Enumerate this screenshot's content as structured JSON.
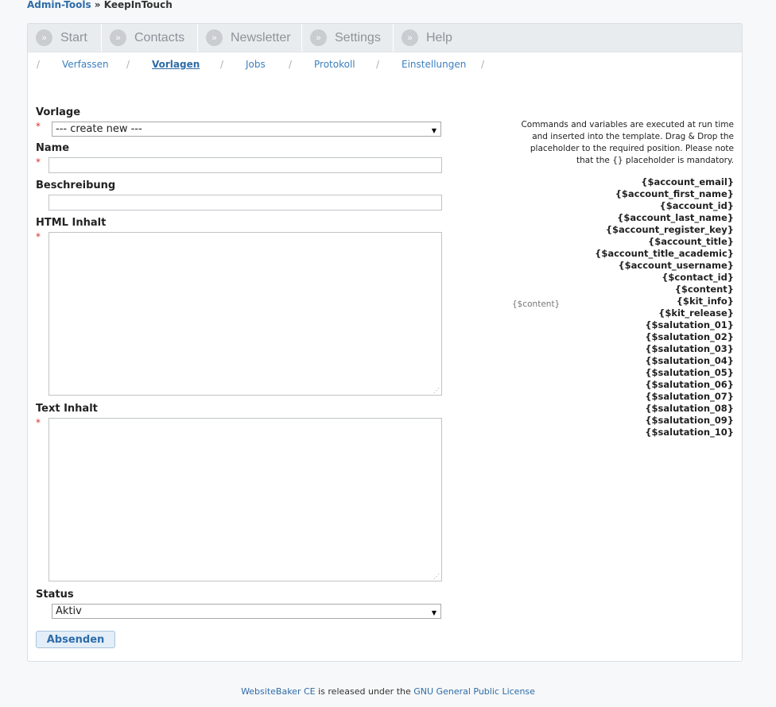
{
  "breadcrumb": {
    "root": "Admin-Tools",
    "separator": "»",
    "current": "KeepInTouch"
  },
  "main_nav": {
    "start": "Start",
    "contacts": "Contacts",
    "newsletter": "Newsletter",
    "settings": "Settings",
    "help": "Help"
  },
  "sub_nav": {
    "verfassen": "Verfassen",
    "vorlagen": "Vorlagen",
    "jobs": "Jobs",
    "protokoll": "Protokoll",
    "einstellungen": "Einstellungen",
    "slash": "/"
  },
  "form": {
    "vorlage_label": "Vorlage",
    "vorlage_value": "--- create new ---",
    "name_label": "Name",
    "beschreibung_label": "Beschreibung",
    "html_label": "HTML Inhalt",
    "text_label": "Text Inhalt",
    "status_label": "Status",
    "status_value": "Aktiv",
    "required_mark": "*",
    "submit": "Absenden"
  },
  "info": {
    "note_line1": "Commands and variables are executed at run time",
    "note_line2": "and inserted into the template. Drag & Drop the",
    "note_line3": "placeholder to the required position. Please note",
    "note_line4": "that the {} placeholder is mandatory.",
    "preview": "{$content}",
    "placeholders": [
      "{$account_email}",
      "{$account_first_name}",
      "{$account_id}",
      "{$account_last_name}",
      "{$account_register_key}",
      "{$account_title}",
      "{$account_title_academic}",
      "{$account_username}",
      "{$contact_id}",
      "{$content}",
      "{$kit_info}",
      "{$kit_release}",
      "{$salutation_01}",
      "{$salutation_02}",
      "{$salutation_03}",
      "{$salutation_04}",
      "{$salutation_05}",
      "{$salutation_06}",
      "{$salutation_07}",
      "{$salutation_08}",
      "{$salutation_09}",
      "{$salutation_10}"
    ]
  },
  "footer": {
    "product": "WebsiteBaker CE",
    "middle": " is released under the ",
    "license": "GNU General Public License"
  }
}
